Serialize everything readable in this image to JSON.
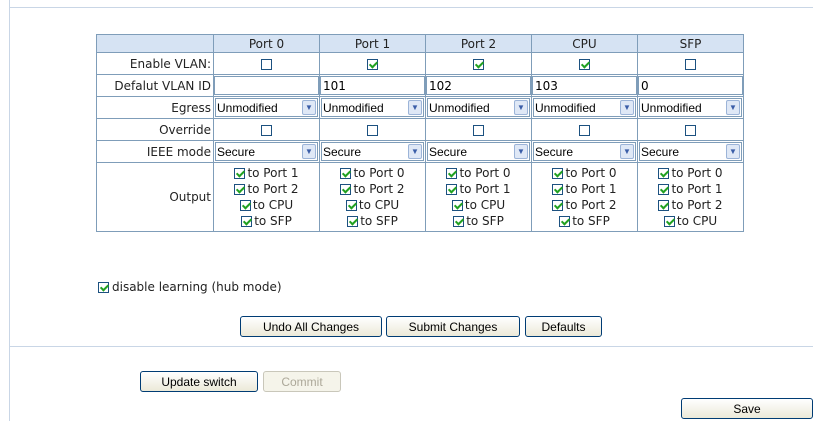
{
  "table": {
    "columns": [
      "Port 0",
      "Port 1",
      "Port 2",
      "CPU",
      "SFP"
    ],
    "rows": {
      "enable_vlan": {
        "label": "Enable VLAN:",
        "values": [
          false,
          true,
          true,
          true,
          false
        ]
      },
      "default_vlan_id": {
        "label": "Defalut VLAN ID",
        "values": [
          "",
          "101",
          "102",
          "103",
          "0"
        ]
      },
      "egress": {
        "label": "Egress",
        "values": [
          "Unmodified",
          "Unmodified",
          "Unmodified",
          "Unmodified",
          "Unmodified"
        ]
      },
      "override": {
        "label": "Override",
        "values": [
          false,
          false,
          false,
          false,
          false
        ]
      },
      "ieee_mode": {
        "label": "IEEE mode",
        "values": [
          "Secure",
          "Secure",
          "Secure",
          "Secure",
          "Secure"
        ]
      },
      "output": {
        "label": "Output",
        "values": [
          [
            "to Port 1",
            "to Port 2",
            "to CPU",
            "to SFP"
          ],
          [
            "to Port 0",
            "to Port 2",
            "to CPU",
            "to SFP"
          ],
          [
            "to Port 0",
            "to Port 1",
            "to CPU",
            "to SFP"
          ],
          [
            "to Port 0",
            "to Port 1",
            "to Port 2",
            "to SFP"
          ],
          [
            "to Port 0",
            "to Port 1",
            "to Port 2",
            "to CPU"
          ]
        ],
        "checked": true
      }
    }
  },
  "hub": {
    "label": "disable learning (hub mode)",
    "checked": true
  },
  "buttons": {
    "undo": "Undo All Changes",
    "submit": "Submit Changes",
    "defaults": "Defaults",
    "update": "Update switch",
    "commit": "Commit",
    "save": "Save"
  }
}
